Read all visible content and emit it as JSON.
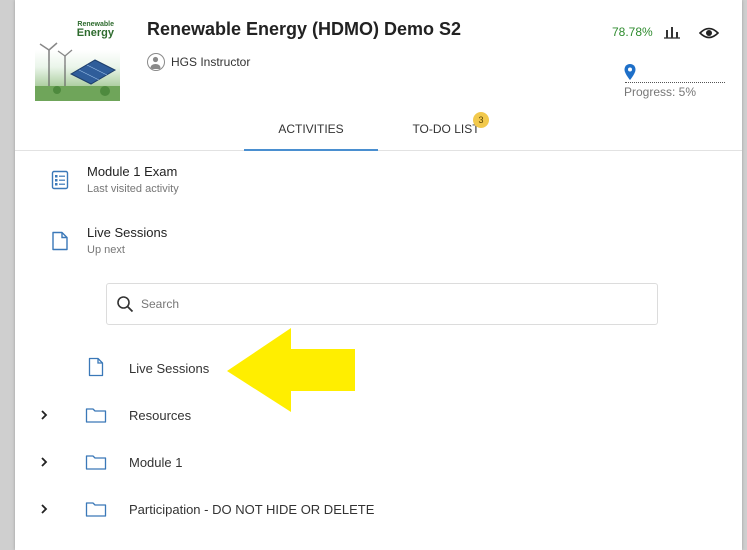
{
  "course": {
    "title": "Renewable Energy (HDMO) Demo S2",
    "instructor": "HGS Instructor",
    "thumbnail_title_small": "Renewable",
    "thumbnail_title_big": "Energy",
    "grade": "78.78%",
    "progress_label": "Progress: 5%",
    "progress_value": 0.05
  },
  "tabs": [
    {
      "label": "ACTIVITIES",
      "active": true
    },
    {
      "label": "TO-DO LIST",
      "badge": "3",
      "active": false
    }
  ],
  "recent": [
    {
      "title": "Module 1 Exam",
      "subtitle": "Last visited activity",
      "icon": "checklist-icon"
    },
    {
      "title": "Live Sessions",
      "subtitle": "Up next",
      "icon": "document-icon"
    }
  ],
  "search": {
    "placeholder": "Search",
    "value": ""
  },
  "tree": [
    {
      "label": "Live Sessions",
      "type": "file"
    },
    {
      "label": "Resources",
      "type": "folder"
    },
    {
      "label": "Module 1",
      "type": "folder"
    },
    {
      "label": "Participation - DO NOT HIDE OR DELETE",
      "type": "folder"
    }
  ],
  "colors": {
    "accent": "#4a8fd0",
    "grade": "#2e8b2e",
    "badge": "#f2c94c",
    "arrow": "#ffee00"
  }
}
